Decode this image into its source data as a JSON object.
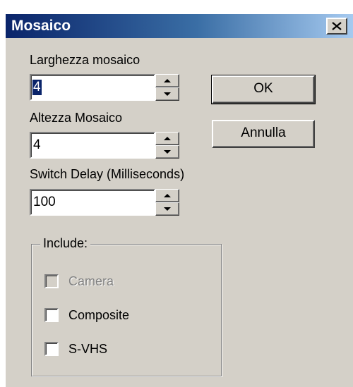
{
  "window": {
    "title": "Mosaico",
    "close_symbol": "✕"
  },
  "fields": [
    {
      "label": "Larghezza mosaico",
      "value": "4"
    },
    {
      "label": "Altezza Mosaico",
      "value": "4"
    },
    {
      "label": "Switch Delay (Milliseconds)",
      "value": "100"
    }
  ],
  "buttons": {
    "ok": "OK",
    "cancel": "Annulla"
  },
  "include_group": {
    "legend": "Include:",
    "options": [
      {
        "label": "Camera",
        "checked": false,
        "disabled": true
      },
      {
        "label": "Composite",
        "checked": false,
        "disabled": false
      },
      {
        "label": "S-VHS",
        "checked": false,
        "disabled": false
      }
    ]
  },
  "colors": {
    "title_gradient_start": "#0a246a",
    "title_gradient_end": "#a6caf0",
    "face": "#d4d0c8",
    "selection": "#0a246a"
  }
}
